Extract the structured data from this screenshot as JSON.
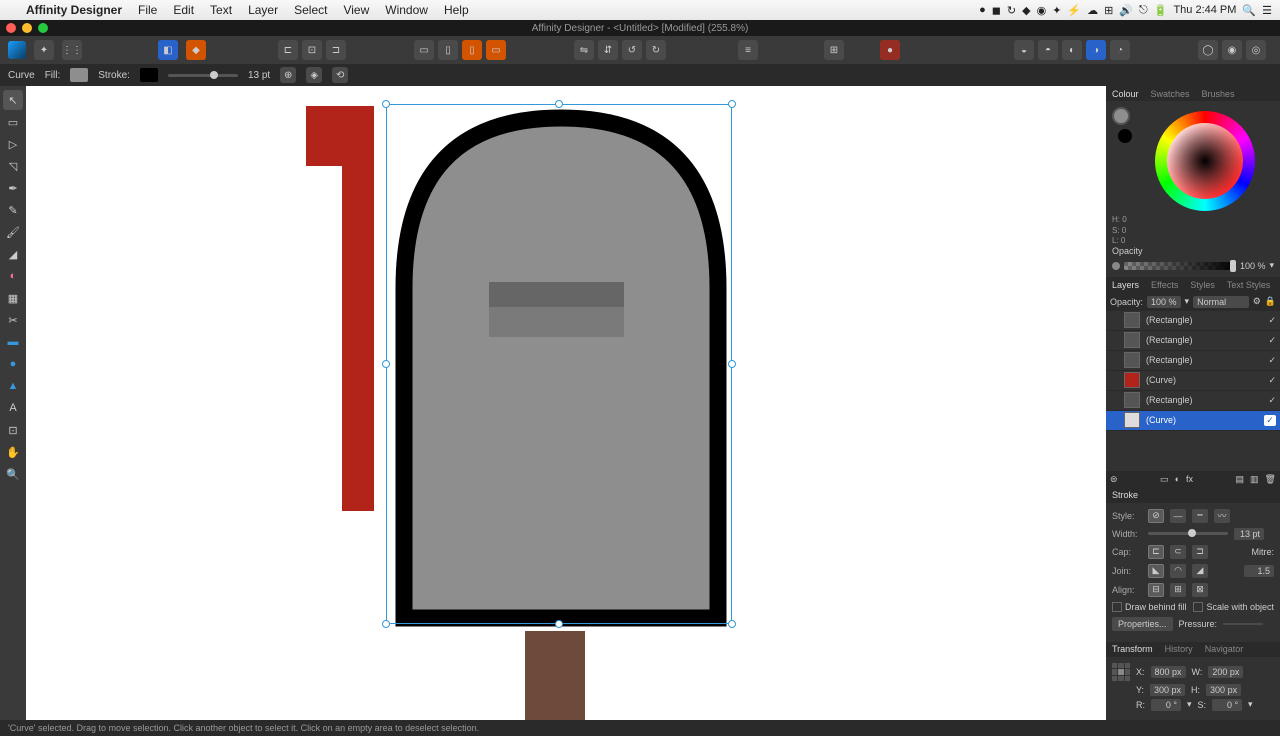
{
  "menubar": {
    "app": "Affinity Designer",
    "items": [
      "File",
      "Edit",
      "Text",
      "Layer",
      "Select",
      "View",
      "Window",
      "Help"
    ],
    "clock": "Thu 2:44 PM"
  },
  "window": {
    "title": "Affinity Designer - <Untitled> [Modified] (255.8%)"
  },
  "contextbar": {
    "object": "Curve",
    "fill_label": "Fill:",
    "stroke_label": "Stroke:",
    "stroke_width": "13 pt",
    "fill_color": "#8e8e8e",
    "stroke_color": "#000000"
  },
  "tools": [
    "move",
    "node",
    "corner",
    "pen",
    "pencil",
    "brush",
    "fill",
    "gradient",
    "transparency",
    "place",
    "crop",
    "shape",
    "rect",
    "ellipse",
    "text",
    "vector",
    "pan",
    "zoom"
  ],
  "colour": {
    "tab1": "Colour",
    "tab2": "Swatches",
    "tab3": "Brushes",
    "h": "H: 0",
    "s": "S: 0",
    "l": "L: 0",
    "opacity_label": "Opacity",
    "opacity_value": "100 %"
  },
  "layers": {
    "tabs": [
      "Layers",
      "Effects",
      "Styles",
      "Text Styles"
    ],
    "opacity_label": "Opacity:",
    "opacity_value": "100 %",
    "blend": "Normal",
    "items": [
      {
        "name": "(Rectangle)",
        "selected": false
      },
      {
        "name": "(Rectangle)",
        "selected": false
      },
      {
        "name": "(Rectangle)",
        "selected": false
      },
      {
        "name": "(Curve)",
        "selected": false
      },
      {
        "name": "(Rectangle)",
        "selected": false
      },
      {
        "name": "(Curve)",
        "selected": true
      }
    ]
  },
  "stroke": {
    "heading": "Stroke",
    "style": "Style:",
    "width": "Width:",
    "width_val": "13 pt",
    "cap": "Cap:",
    "join": "Join:",
    "align": "Align:",
    "mitre": "Mitre:",
    "mitre_val": "1.5",
    "draw_behind": "Draw behind fill",
    "scale_with": "Scale with object",
    "properties": "Properties...",
    "pressure": "Pressure:"
  },
  "transform": {
    "tabs": [
      "Transform",
      "History",
      "Navigator"
    ],
    "x": "X:",
    "x_val": "800 px",
    "y": "Y:",
    "y_val": "300 px",
    "w": "W:",
    "w_val": "200 px",
    "h": "H:",
    "h_val": "300 px",
    "r": "R:",
    "r_val": "0 °",
    "s": "S:",
    "s_val": "0 °"
  },
  "status": "'Curve' selected. Drag to move selection. Click another object to select it. Click on an empty area to deselect selection."
}
